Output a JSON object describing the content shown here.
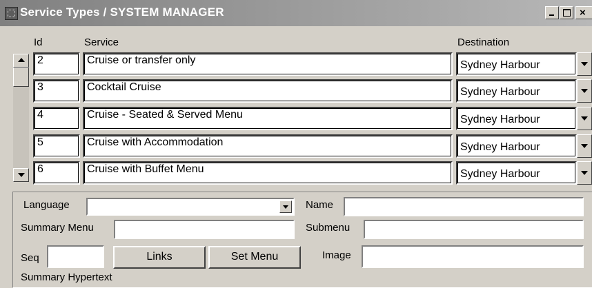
{
  "window": {
    "title": "Service Types / SYSTEM MANAGER"
  },
  "grid": {
    "headers": {
      "id": "Id",
      "service": "Service",
      "destination": "Destination"
    },
    "rows": [
      {
        "id": "2",
        "service": "Cruise or transfer only",
        "destination": "Sydney Harbour"
      },
      {
        "id": "3",
        "service": "Cocktail Cruise",
        "destination": "Sydney Harbour"
      },
      {
        "id": "4",
        "service": "Cruise - Seated & Served Menu",
        "destination": "Sydney Harbour"
      },
      {
        "id": "5",
        "service": "Cruise with Accommodation",
        "destination": "Sydney Harbour"
      },
      {
        "id": "6",
        "service": "Cruise with Buffet Menu",
        "destination": "Sydney Harbour"
      }
    ]
  },
  "form": {
    "language_label": "Language",
    "language_value": "",
    "name_label": "Name",
    "name_value": "",
    "summary_menu_label": "Summary Menu",
    "summary_menu_value": "",
    "submenu_label": "Submenu",
    "submenu_value": "",
    "seq_label": "Seq",
    "seq_value": "",
    "links_button": "Links",
    "set_menu_button": "Set Menu",
    "image_label": "Image",
    "image_value": "",
    "summary_hypertext_label": "Summary Hypertext"
  },
  "colors": {
    "window_bg": "#d4d0c8",
    "titlebar": "#808080",
    "field_bg": "#ffffff"
  },
  "icons": {
    "app": "app-icon",
    "minimize": "minimize-icon",
    "maximize": "maximize-icon",
    "close": "close-icon",
    "scroll_up": "arrow-up-icon",
    "scroll_down": "arrow-down-icon",
    "dropdown": "chevron-down-icon"
  }
}
